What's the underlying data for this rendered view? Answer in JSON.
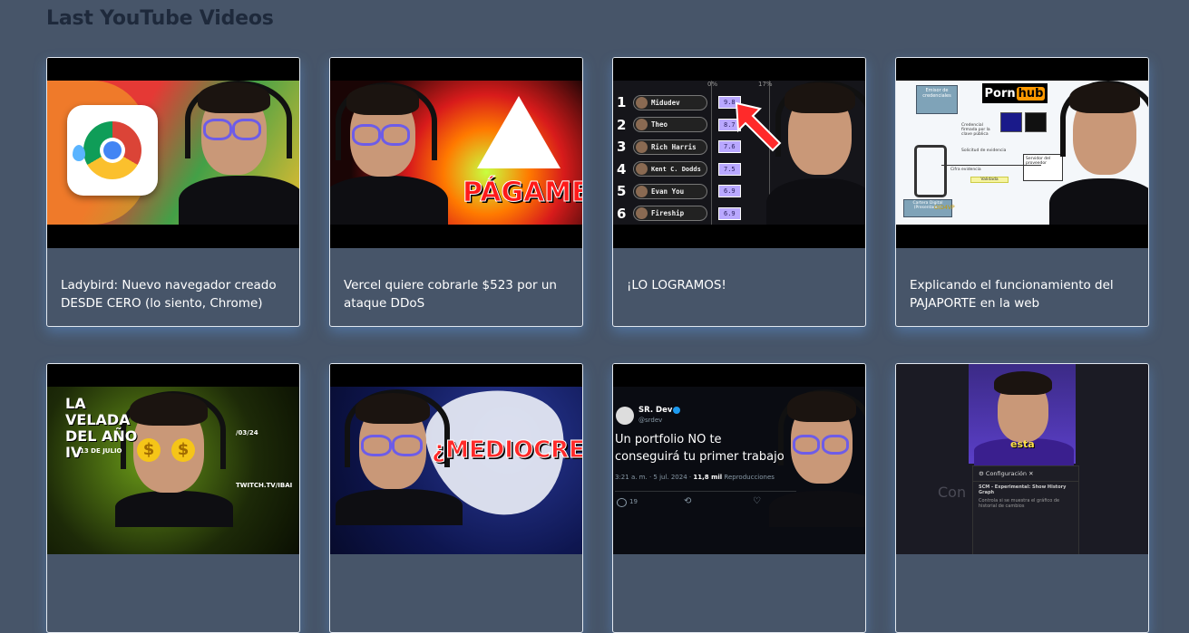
{
  "section": {
    "title": "Last YouTube Videos"
  },
  "videos": [
    {
      "title": "Ladybird: Nuevo navegador creado DESDE CERO (lo siento, Chrome)"
    },
    {
      "title": "Vercel quiere cobrarle $523 por un ataque DDoS",
      "thumb_text": "PÁGAME"
    },
    {
      "title": "¡LO LOGRAMOS!",
      "ranking": [
        {
          "rank": "1",
          "name": "Midudev",
          "score": "9.8"
        },
        {
          "rank": "2",
          "name": "Theo",
          "score": "8.7"
        },
        {
          "rank": "3",
          "name": "Rich Harris",
          "score": "7.6"
        },
        {
          "rank": "4",
          "name": "Kent C. Dodds",
          "score": "7.5"
        },
        {
          "rank": "5",
          "name": "Evan You",
          "score": "6.9"
        },
        {
          "rank": "6",
          "name": "Fireship",
          "score": "6.9"
        }
      ],
      "scale_labels": [
        "0%",
        "17%"
      ]
    },
    {
      "title": "Explicando el funcionamiento del PAJAPORTE en la web",
      "diagram": {
        "box1": "Emisor de credenciales",
        "box2": "Cartera Digital (Presentador)",
        "box3": "Servidor del proveedor",
        "label1": "Credencial firmada por la clave pública",
        "label2": "Solicitud de evidencia",
        "label3": "Cifra evidencia",
        "label4": "Validada",
        "label5": "OID4VP",
        "logo": "Porn hub"
      }
    },
    {
      "title": "",
      "thumb_text_1": "LA VELADA DEL AÑO IV",
      "thumb_text_2": "13 DE JULIO",
      "thumb_text_3": "TWITCH.TV/IBAI",
      "thumb_text_4": "/03/24"
    },
    {
      "title": "",
      "thumb_text": "¿MEDIOCRES?"
    },
    {
      "title": "",
      "tweet": {
        "name": "SR. Dev",
        "handle": "@srdev",
        "text": "Un portfolio NO te conseguirá tu primer trabajo",
        "meta": "3:21 a. m. · 5 jul. 2024 · ",
        "views": "11,8 mil",
        "views_label": "Reproducciones",
        "replies": "19"
      }
    },
    {
      "title": "",
      "caption": "esta",
      "popup_title": "Configuración",
      "popup_item": "SCM - Experimental: Show History Graph",
      "popup_desc": "Controla si se muestra el gráfico de historial de cambios",
      "bg_label": "Con"
    }
  ],
  "colors": {
    "page_bg": "#475569",
    "title_color": "#1e293b",
    "card_border": "#e2e8f0",
    "card_glow": "#60a5fa"
  }
}
